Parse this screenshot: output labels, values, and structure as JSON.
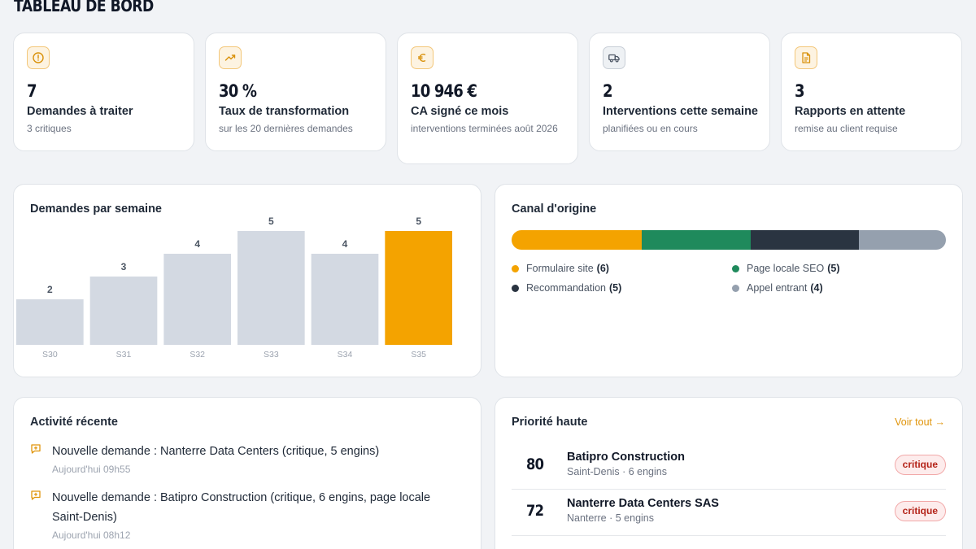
{
  "page": {
    "title": "TABLEAU DE BORD"
  },
  "kpis": [
    {
      "icon": "alert-circle-icon",
      "value": "7",
      "label": "Demandes à traiter",
      "sub": "3 critiques"
    },
    {
      "icon": "trending-up-icon",
      "value": "30 %",
      "label": "Taux de transformation",
      "sub": "sur les 20 dernières demandes"
    },
    {
      "icon": "euro-icon",
      "value": "10 946 €",
      "label": "CA signé ce mois",
      "sub": "interventions terminées août 2026"
    },
    {
      "icon": "truck-icon",
      "value": "2",
      "label": "Interventions cette semaine",
      "sub": "planifiées ou en cours"
    },
    {
      "icon": "document-icon",
      "value": "3",
      "label": "Rapports en attente",
      "sub": "remise au client requise"
    }
  ],
  "weekly_chart": {
    "title": "Demandes par semaine"
  },
  "chart_data": {
    "type": "bar",
    "categories": [
      "S30",
      "S31",
      "S32",
      "S33",
      "S34",
      "S35"
    ],
    "values": [
      2,
      3,
      4,
      5,
      4,
      5
    ],
    "highlight_index": 5,
    "ylim": [
      0,
      5
    ],
    "colors": {
      "default": "#d3d9e2",
      "highlight": "#f4a300"
    }
  },
  "canal": {
    "title": "Canal d'origine",
    "channels": [
      {
        "name": "Formulaire site",
        "count": 6,
        "count_label": "(6)",
        "color": "#f4a300"
      },
      {
        "name": "Page locale SEO",
        "count": 5,
        "count_label": "(5)",
        "color": "#1f8a5c"
      },
      {
        "name": "Recommandation",
        "count": 5,
        "count_label": "(5)",
        "color": "#2a3441"
      },
      {
        "name": "Appel entrant",
        "count": 4,
        "count_label": "(4)",
        "color": "#95a0ae"
      }
    ]
  },
  "activity": {
    "title": "Activité récente",
    "items": [
      {
        "text": "Nouvelle demande : Nanterre Data Centers (critique, 5 engins)",
        "time": "Aujourd'hui 09h55"
      },
      {
        "text": "Nouvelle demande : Batipro Construction (critique, 6 engins, page locale Saint-Denis)",
        "time": "Aujourd'hui 08h12"
      }
    ]
  },
  "priority": {
    "title": "Priorité haute",
    "see_all": "Voir tout →",
    "rows": [
      {
        "score": "80",
        "name": "Batipro Construction",
        "meta": "Saint-Denis · 6 engins",
        "badge": "critique"
      },
      {
        "score": "72",
        "name": "Nanterre Data Centers SAS",
        "meta": "Nanterre · 5 engins",
        "badge": "critique"
      }
    ]
  }
}
